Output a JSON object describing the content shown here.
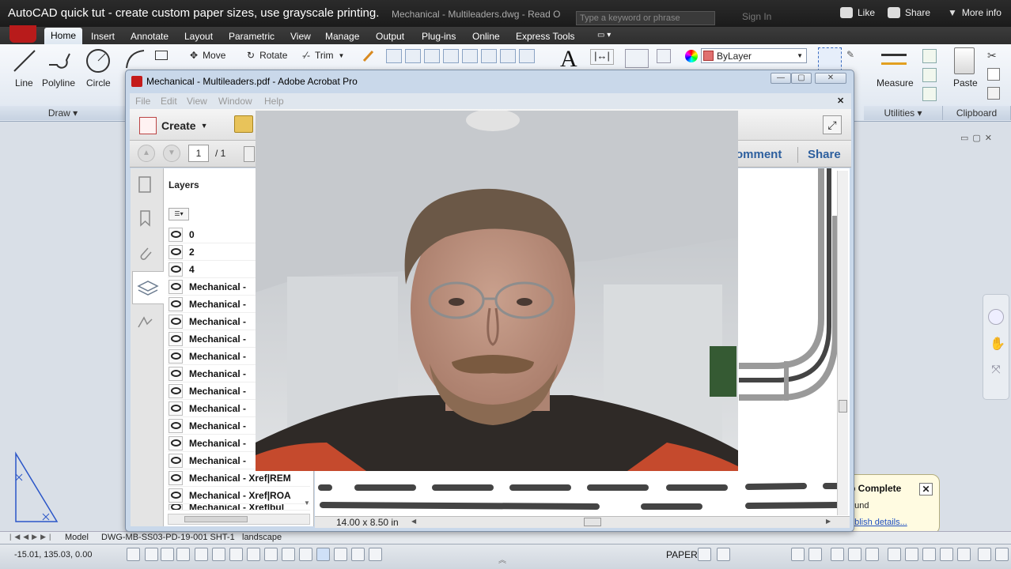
{
  "youtube": {
    "title": "AutoCAD quick tut - create custom paper sizes, use grayscale printing.",
    "actions": [
      "Like",
      "Share",
      "More info"
    ]
  },
  "autocad": {
    "title_fragment": "Mechanical - Multileaders.dwg - Read O",
    "search_placeholder": "Type a keyword or phrase",
    "sign_in": "Sign In",
    "ribbon_tabs": [
      "Home",
      "Insert",
      "Annotate",
      "Layout",
      "Parametric",
      "View",
      "Manage",
      "Output",
      "Plug-ins",
      "Online",
      "Express Tools"
    ],
    "active_tab": "Home",
    "draw_tools": [
      "Line",
      "Polyline",
      "Circle"
    ],
    "modify_tools": [
      "Move",
      "Rotate",
      "Trim"
    ],
    "panels": [
      "Draw",
      "Utilities",
      "Clipboard"
    ],
    "layer_dropdown": "ByLayer",
    "measure_label": "Measure",
    "paste_label": "Paste",
    "layout_tabs": [
      "Model",
      "DWG-MB-SS03-PD-19-001 SHT-1",
      "landscape"
    ],
    "coordinates": "-15.01, 135.03, 0.00",
    "space_label": "PAPER",
    "notification": {
      "title": "p Complete",
      "line1": "ound",
      "link": "ublish details..."
    }
  },
  "acrobat": {
    "title": "Mechanical - Multileaders.pdf - Adobe Acrobat Pro",
    "menu": [
      "File",
      "Edit",
      "View",
      "Window",
      "Help"
    ],
    "create_label": "Create",
    "page_current": "1",
    "page_total": "/ 1",
    "comment_label": "omment",
    "share_label": "Share",
    "layers_title": "Layers",
    "layers": [
      "0",
      "2",
      "4",
      "Mechanical -",
      "Mechanical -",
      "Mechanical -",
      "Mechanical -",
      "Mechanical -",
      "Mechanical -",
      "Mechanical -",
      "Mechanical -",
      "Mechanical -",
      "Mechanical -",
      "Mechanical -",
      "Mechanical - Xref|REM",
      "Mechanical - Xref|ROA",
      "Mechanical - Xref|bul"
    ],
    "page_size": "14.00 x 8.50 in"
  }
}
